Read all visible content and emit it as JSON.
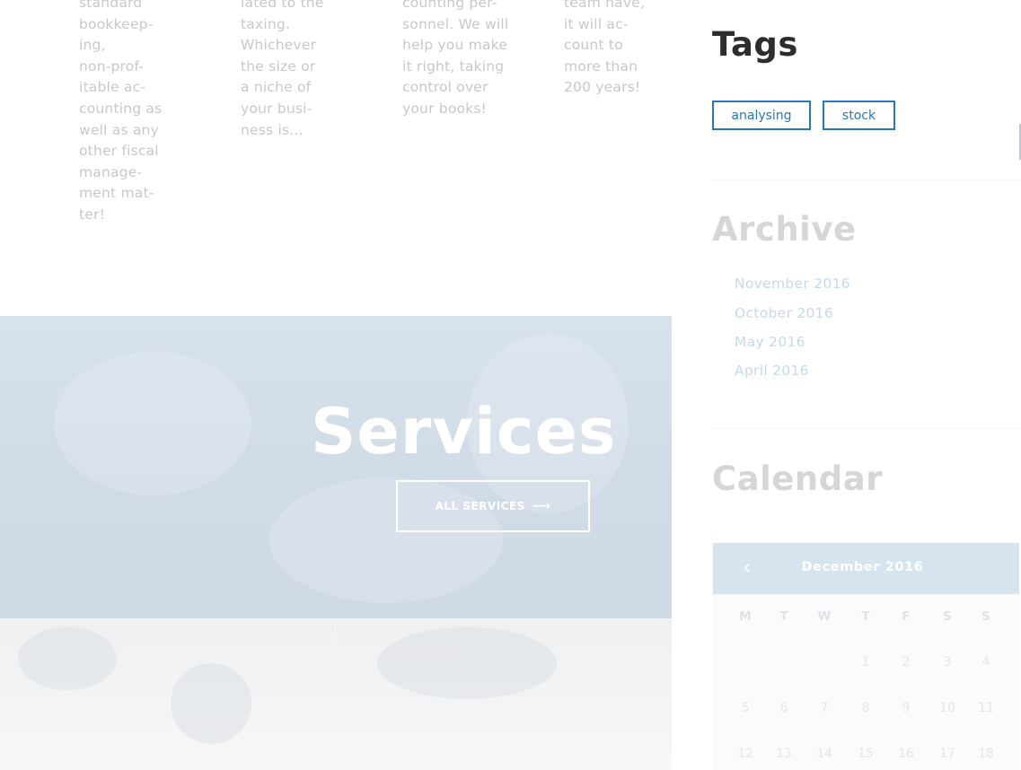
{
  "columns": [
    {
      "text": "standard\nbookkeep-\ning,\nnon-prof-\nitable ac-\ncounting as\nwell as any\nother fiscal\nmanage-\nment mat-\nter!"
    },
    {
      "text": "lated to the\ntaxing.\nWhichever\nthe size or\na niche of\nyour busi-\nness is..."
    },
    {
      "text": "counting per-\nsonnel. We will\nhelp you make\nit right, taking\ncontrol over\nyour books!"
    },
    {
      "text": "team have,\nit will ac-\ncount to\nmore than\n200 years!"
    }
  ],
  "hero": {
    "title": "Services",
    "button_label": "ALL SERVICES",
    "button_icon": "arrow-right-icon",
    "button_arrow": "⟶"
  },
  "tags": {
    "title": "Tags",
    "items": [
      "analysing",
      "stock"
    ]
  },
  "archive": {
    "title": "Archive",
    "items": [
      "November 2016",
      "October 2016",
      "May 2016",
      "April 2016"
    ]
  },
  "calendar": {
    "title": "Calendar",
    "month_label": "December 2016",
    "prev_icon": "chevron-left-icon",
    "prev_glyph": "‹",
    "weekdays": [
      "M",
      "T",
      "W",
      "T",
      "F",
      "S",
      "S"
    ],
    "weeks": [
      [
        "",
        "",
        "",
        "1",
        "2",
        "3",
        "4"
      ],
      [
        "5",
        "6",
        "7",
        "8",
        "9",
        "10",
        "11"
      ],
      [
        "12",
        "13",
        "14",
        "15",
        "16",
        "17",
        "18"
      ]
    ]
  },
  "colors": {
    "tag_border": "#2a77b8",
    "title_dark": "#2d2d2d",
    "title_faded": "#d6d6d6",
    "hero_bg": "#d3dfea"
  }
}
